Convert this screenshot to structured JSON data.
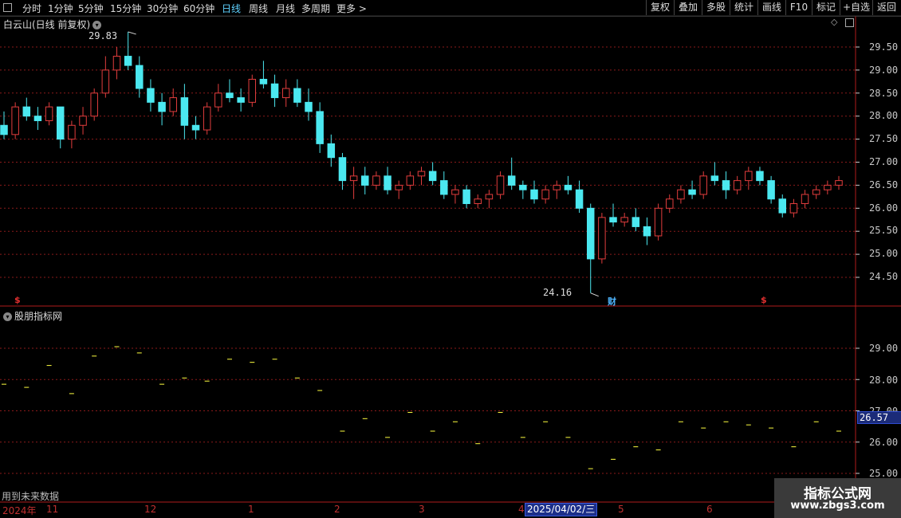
{
  "toolbar": {
    "periods": [
      "分时",
      "1分钟",
      "5分钟",
      "15分钟",
      "30分钟",
      "60分钟",
      "日线",
      "周线",
      "月线",
      "多周期",
      "更多 >"
    ],
    "active_period": "日线",
    "buttons": [
      "复权",
      "叠加",
      "多股",
      "统计",
      "画线",
      "F10",
      "标记",
      "+自选",
      "返回"
    ]
  },
  "main_chart": {
    "title": "白云山(日线 前复权)",
    "high_label": "29.83",
    "low_label": "24.16",
    "price_ticks": [
      "29.50",
      "29.00",
      "28.50",
      "28.00",
      "27.50",
      "27.00",
      "26.50",
      "26.00",
      "25.50",
      "25.00",
      "24.50"
    ],
    "markers": [
      {
        "text": "$",
        "color": "#e23030"
      },
      {
        "text": "财",
        "color": "#4fb6ff"
      },
      {
        "text": "$",
        "color": "#e23030"
      }
    ]
  },
  "indicator": {
    "title": "股朋指标网",
    "ticks": [
      "29.00",
      "28.00",
      "27.00",
      "26.00",
      "25.00"
    ],
    "current_value": "26.57",
    "note": "用到未来数据"
  },
  "time_axis": {
    "labels": [
      "2024年",
      "11",
      "12",
      "1",
      "2",
      "3",
      "4",
      "5",
      "6"
    ],
    "cursor_date": "2025/04/02/三"
  },
  "watermark": {
    "line1": "指标公式网",
    "line2": "www.zbgs3.com"
  },
  "colors": {
    "up": "#e23d3d",
    "down": "#4be8f0",
    "grid": "#8a1a1a",
    "frame": "#b01b1b",
    "indicator": "#ffff40"
  },
  "chart_data": {
    "type": "candlestick",
    "title": "白云山(日线 前复权)",
    "ylim": [
      24.0,
      30.1
    ],
    "high": 29.83,
    "low": 24.16,
    "x_labels": [
      "2024年",
      "11",
      "12",
      "1",
      "2",
      "3",
      "4",
      "5",
      "6"
    ],
    "ohlc": [
      [
        27.8,
        28.1,
        27.5,
        27.6
      ],
      [
        27.6,
        28.3,
        27.5,
        28.2
      ],
      [
        28.2,
        28.4,
        27.9,
        28.0
      ],
      [
        28.0,
        28.2,
        27.7,
        27.9
      ],
      [
        27.9,
        28.3,
        27.8,
        28.2
      ],
      [
        28.2,
        28.2,
        27.3,
        27.5
      ],
      [
        27.5,
        27.9,
        27.3,
        27.8
      ],
      [
        27.8,
        28.2,
        27.6,
        28.0
      ],
      [
        28.0,
        28.6,
        27.9,
        28.5
      ],
      [
        28.5,
        29.3,
        28.4,
        29.0
      ],
      [
        29.0,
        29.5,
        28.8,
        29.3
      ],
      [
        29.3,
        29.83,
        29.0,
        29.1
      ],
      [
        29.1,
        29.3,
        28.4,
        28.6
      ],
      [
        28.6,
        28.8,
        28.1,
        28.3
      ],
      [
        28.3,
        28.5,
        27.8,
        28.1
      ],
      [
        28.1,
        28.6,
        28.0,
        28.4
      ],
      [
        28.4,
        28.7,
        27.5,
        27.8
      ],
      [
        27.8,
        28.0,
        27.5,
        27.7
      ],
      [
        27.7,
        28.3,
        27.6,
        28.2
      ],
      [
        28.2,
        28.7,
        28.1,
        28.5
      ],
      [
        28.5,
        28.8,
        28.3,
        28.4
      ],
      [
        28.4,
        28.6,
        28.1,
        28.3
      ],
      [
        28.3,
        28.9,
        28.2,
        28.8
      ],
      [
        28.8,
        29.2,
        28.6,
        28.7
      ],
      [
        28.7,
        28.9,
        28.2,
        28.4
      ],
      [
        28.4,
        28.8,
        28.2,
        28.6
      ],
      [
        28.6,
        28.8,
        28.2,
        28.3
      ],
      [
        28.3,
        28.6,
        27.9,
        28.1
      ],
      [
        28.1,
        28.3,
        27.2,
        27.4
      ],
      [
        27.4,
        27.6,
        26.9,
        27.1
      ],
      [
        27.1,
        27.2,
        26.4,
        26.6
      ],
      [
        26.6,
        26.9,
        26.2,
        26.7
      ],
      [
        26.7,
        26.9,
        26.3,
        26.5
      ],
      [
        26.5,
        26.8,
        26.4,
        26.7
      ],
      [
        26.7,
        26.9,
        26.3,
        26.4
      ],
      [
        26.4,
        26.6,
        26.2,
        26.5
      ],
      [
        26.5,
        26.8,
        26.4,
        26.7
      ],
      [
        26.7,
        26.9,
        26.5,
        26.8
      ],
      [
        26.8,
        27.0,
        26.5,
        26.6
      ],
      [
        26.6,
        26.8,
        26.2,
        26.3
      ],
      [
        26.3,
        26.5,
        26.1,
        26.4
      ],
      [
        26.4,
        26.5,
        26.0,
        26.1
      ],
      [
        26.1,
        26.3,
        26.0,
        26.2
      ],
      [
        26.2,
        26.4,
        26.0,
        26.3
      ],
      [
        26.3,
        26.8,
        26.2,
        26.7
      ],
      [
        26.7,
        27.1,
        26.4,
        26.5
      ],
      [
        26.5,
        26.6,
        26.2,
        26.4
      ],
      [
        26.4,
        26.6,
        26.1,
        26.2
      ],
      [
        26.2,
        26.5,
        26.1,
        26.4
      ],
      [
        26.4,
        26.6,
        26.2,
        26.5
      ],
      [
        26.5,
        26.7,
        26.3,
        26.4
      ],
      [
        26.4,
        26.6,
        25.9,
        26.0
      ],
      [
        26.0,
        26.1,
        24.16,
        24.9
      ],
      [
        24.9,
        25.9,
        24.8,
        25.8
      ],
      [
        25.8,
        26.1,
        25.6,
        25.7
      ],
      [
        25.7,
        25.9,
        25.6,
        25.8
      ],
      [
        25.8,
        26.0,
        25.5,
        25.6
      ],
      [
        25.6,
        25.8,
        25.2,
        25.4
      ],
      [
        25.4,
        26.1,
        25.3,
        26.0
      ],
      [
        26.0,
        26.3,
        25.9,
        26.2
      ],
      [
        26.2,
        26.5,
        26.1,
        26.4
      ],
      [
        26.4,
        26.6,
        26.2,
        26.3
      ],
      [
        26.3,
        26.8,
        26.2,
        26.7
      ],
      [
        26.7,
        27.0,
        26.5,
        26.6
      ],
      [
        26.6,
        26.8,
        26.2,
        26.4
      ],
      [
        26.4,
        26.7,
        26.3,
        26.6
      ],
      [
        26.6,
        26.9,
        26.4,
        26.8
      ],
      [
        26.8,
        26.9,
        26.5,
        26.6
      ],
      [
        26.6,
        26.7,
        26.1,
        26.2
      ],
      [
        26.2,
        26.3,
        25.8,
        25.9
      ],
      [
        25.9,
        26.2,
        25.8,
        26.1
      ],
      [
        26.1,
        26.4,
        26.0,
        26.3
      ],
      [
        26.3,
        26.5,
        26.2,
        26.4
      ],
      [
        26.4,
        26.6,
        26.3,
        26.5
      ],
      [
        26.5,
        26.7,
        26.4,
        26.6
      ]
    ]
  }
}
